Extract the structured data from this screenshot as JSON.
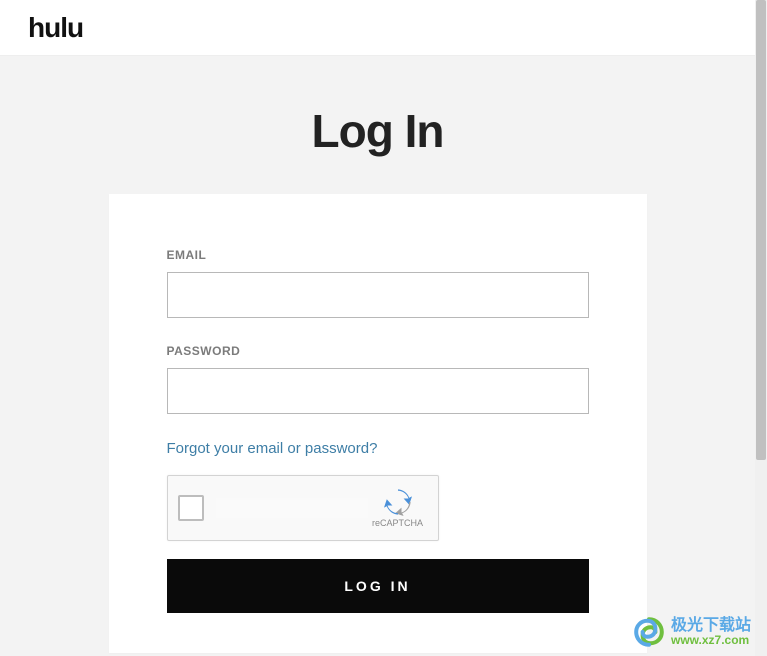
{
  "header": {
    "logo_text": "hulu"
  },
  "page": {
    "title": "Log In"
  },
  "form": {
    "email_label": "EMAIL",
    "email_value": "",
    "password_label": "PASSWORD",
    "password_value": "",
    "forgot_link": "Forgot your email or password?",
    "recaptcha_label": "reCAPTCHA",
    "login_button": "LOG IN"
  },
  "watermark": {
    "cn_text": "极光下载站",
    "url_text": "www.xz7.com"
  }
}
